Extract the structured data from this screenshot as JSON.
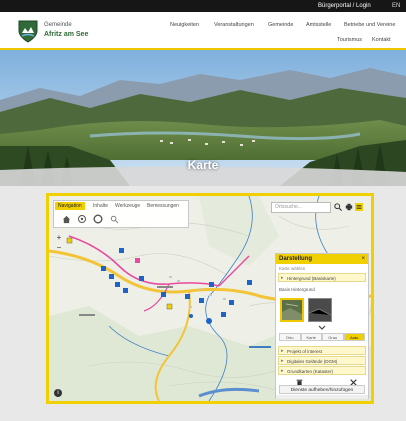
{
  "topbar": {
    "login_link": "Bürgerportal / Login",
    "language": "EN"
  },
  "logo": {
    "line1": "Gemeinde",
    "line2": "Afritz am See"
  },
  "nav": [
    {
      "label": "Neuigkeiten"
    },
    {
      "label": "Veranstaltungen"
    },
    {
      "label": "Gemeinde"
    },
    {
      "label": "Amtsstelle"
    },
    {
      "label": "Betriebe und Vereine"
    },
    {
      "label": "Tourismus"
    },
    {
      "label": "Kontakt"
    }
  ],
  "hero": {
    "title": "Karte"
  },
  "map": {
    "tabs": [
      {
        "label": "Navigation",
        "active": true
      },
      {
        "label": "Inhalte",
        "active": false
      },
      {
        "label": "Werkzeuge",
        "active": false
      },
      {
        "label": "Bemessungen",
        "active": false
      }
    ],
    "tools": [
      "home-icon",
      "locate-icon",
      "circle-icon",
      "search-small-icon"
    ],
    "search_placeholder": "Ortssuche...",
    "zoom_in": "+",
    "zoom_out": "−",
    "info_button": "i",
    "panel": {
      "title": "Darstellung",
      "close": "×",
      "subtitle": "Karte wählen",
      "row_background": "Hintergrund (Basiskarte)",
      "label_transparency": "Basis Hintergrund",
      "segments": [
        {
          "label": "Orto",
          "on": false
        },
        {
          "label": "Karte",
          "on": false
        },
        {
          "label": "Grau",
          "on": false
        },
        {
          "label": "Auto",
          "on": true
        }
      ],
      "rows": [
        {
          "label": "Projekt of interest"
        },
        {
          "label": "Digitales Gelände (DGM)"
        },
        {
          "label": "Grundkarten (Kataster)"
        }
      ],
      "button": "Dienste aufheben/hinzufügen"
    }
  },
  "colors": {
    "accent_yellow": "#f0d000",
    "topbar": "#161616",
    "route_pink": "#e84aa0",
    "road_yellow": "#f3c338",
    "marker_blue": "#1e64c8",
    "stream_blue": "#3d7fc4"
  }
}
